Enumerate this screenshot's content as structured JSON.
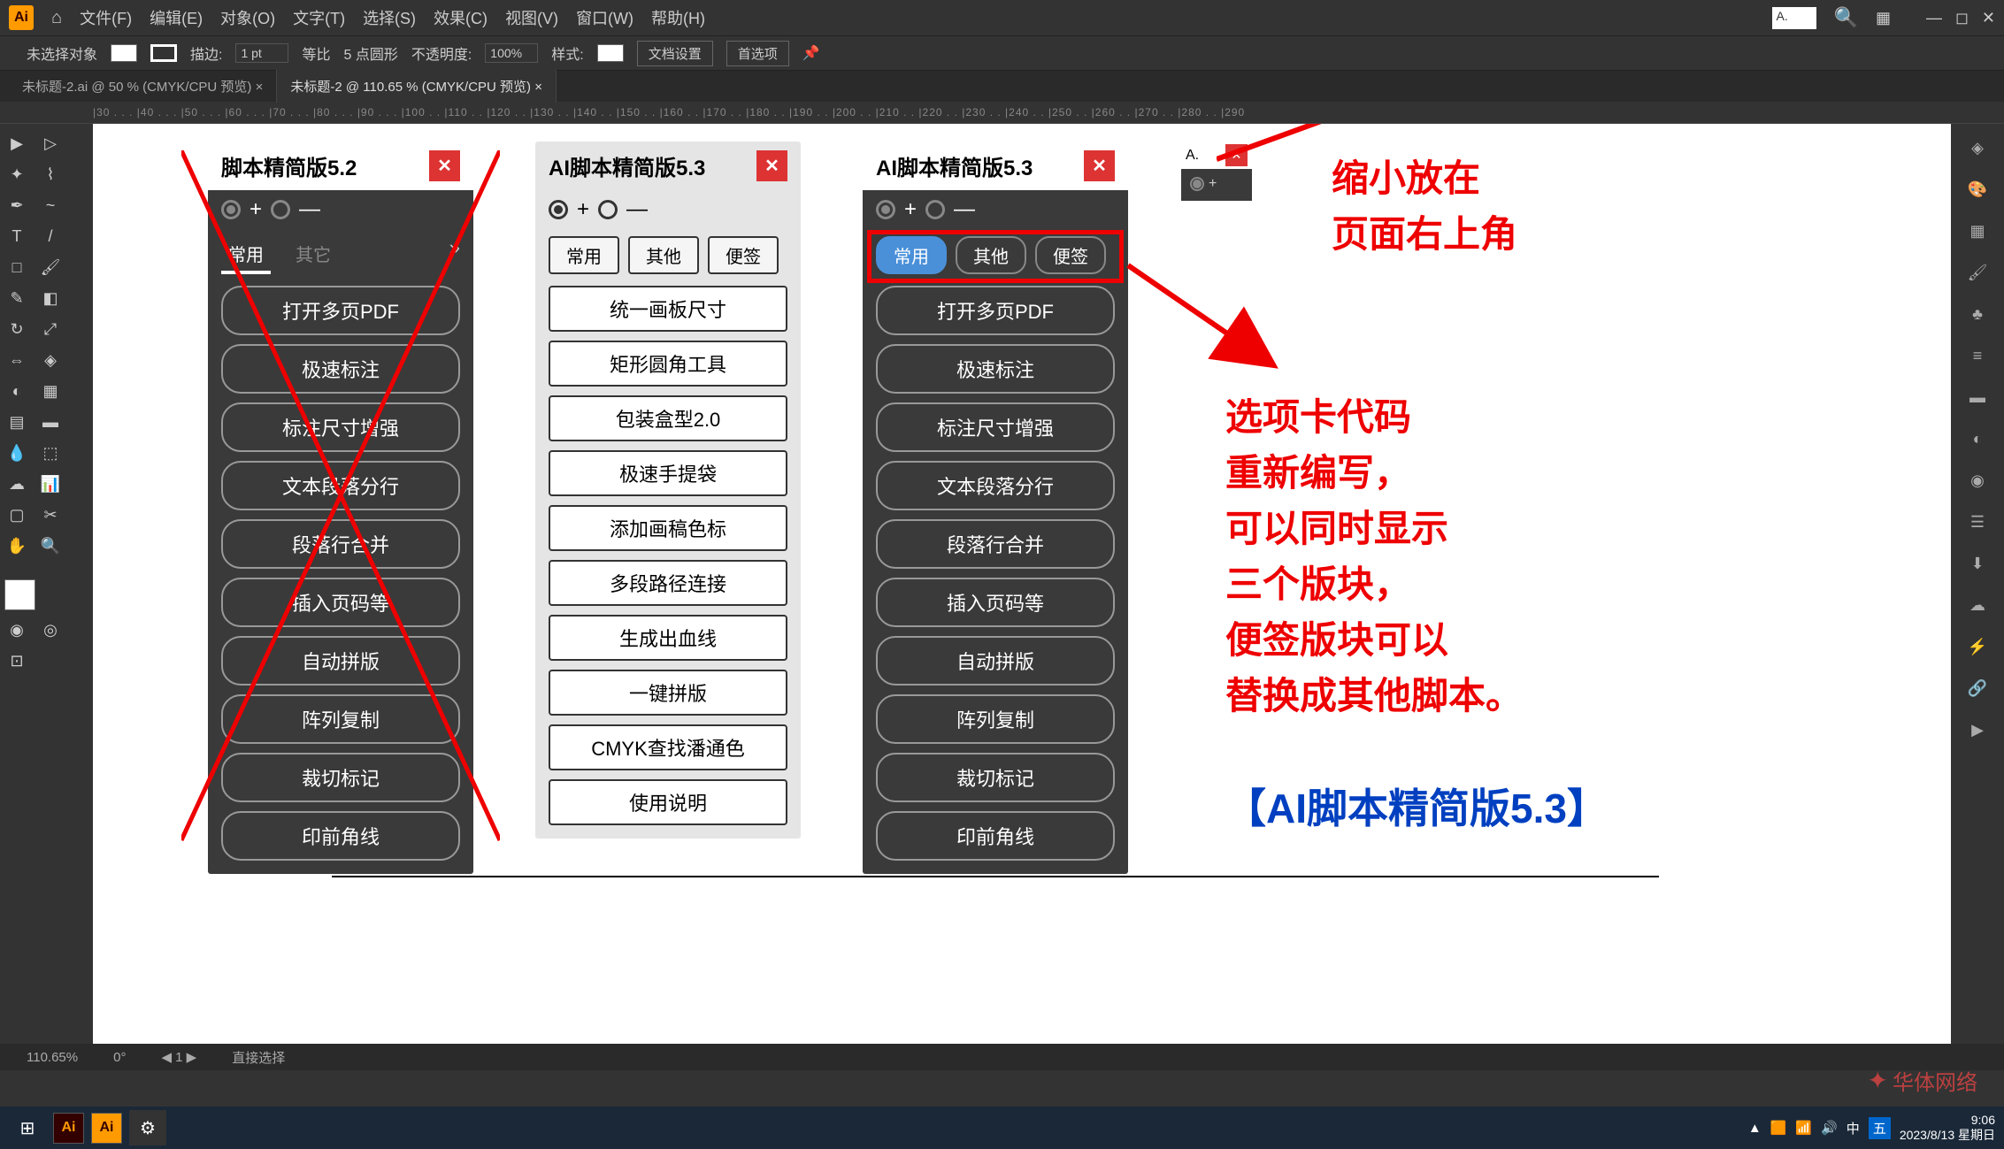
{
  "menubar": {
    "items": [
      "文件(F)",
      "编辑(E)",
      "对象(O)",
      "文字(T)",
      "选择(S)",
      "效果(C)",
      "视图(V)",
      "窗口(W)",
      "帮助(H)"
    ]
  },
  "optbar": {
    "nosel": "未选择对象",
    "stroke_label": "描边:",
    "stroke_val": "1 pt",
    "uniform": "等比",
    "brush": "5 点圆形",
    "opacity_label": "不透明度:",
    "opacity_val": "100%",
    "style": "样式:",
    "docset": "文档设置",
    "prefs": "首选项"
  },
  "tabs": {
    "t1": "未标题-2.ai @ 50 % (CMYK/CPU 预览)",
    "t2": "未标题-2 @ 110.65 % (CMYK/CPU 预览)"
  },
  "ruler_h": "|30 . . . |40 . . . |50 . . . |60 . . . |70 . . . |80 . . . |90 . . . |100 . . |110 . . |120 . . |130 . . |140 . . |150 . . |160 . . |170 . . |180 . . |190 . . |200 . . |210 . . |220 . . |230 . . |240 . . |250 . . |260 . . |270 . . |280 . . |290",
  "panel52": {
    "title": "脚本精简版5.2",
    "tabs": [
      "常用",
      "其它"
    ],
    "btns": [
      "打开多页PDF",
      "极速标注",
      "标注尺寸增强",
      "文本段落分行",
      "段落行合并",
      "插入页码等",
      "自动拼版",
      "阵列复制",
      "裁切标记",
      "印前角线"
    ]
  },
  "panel53light": {
    "title": "AI脚本精简版5.3",
    "tabs": [
      "常用",
      "其他",
      "便签"
    ],
    "btns": [
      "统一画板尺寸",
      "矩形圆角工具",
      "包装盒型2.0",
      "极速手提袋",
      "添加画稿色标",
      "多段路径连接",
      "生成出血线",
      "一键拼版",
      "CMYK查找潘通色",
      "使用说明"
    ]
  },
  "panel53dark": {
    "title": "AI脚本精简版5.3",
    "tabs": [
      "常用",
      "其他",
      "便签"
    ],
    "btns": [
      "打开多页PDF",
      "极速标注",
      "标注尺寸增强",
      "文本段落分行",
      "段落行合并",
      "插入页码等",
      "自动拼版",
      "阵列复制",
      "裁切标记",
      "印前角线"
    ]
  },
  "tiny": {
    "title": "A."
  },
  "annot1_l1": "缩小放在",
  "annot1_l2": "页面右上角",
  "annot2_l1": "选项卡代码",
  "annot2_l2": "重新编写，",
  "annot2_l3": "可以同时显示",
  "annot2_l4": "三个版块，",
  "annot2_l5": "便签版块可以",
  "annot2_l6": "替换成其他脚本。",
  "annot3": "【AI脚本精简版5.3】",
  "status": {
    "zoom": "110.65%",
    "sel": "直接选择"
  },
  "taskbar": {
    "time": "9:06",
    "date": "2023/8/13 星期日"
  },
  "watermark": "华体网络",
  "mini_search": "A."
}
